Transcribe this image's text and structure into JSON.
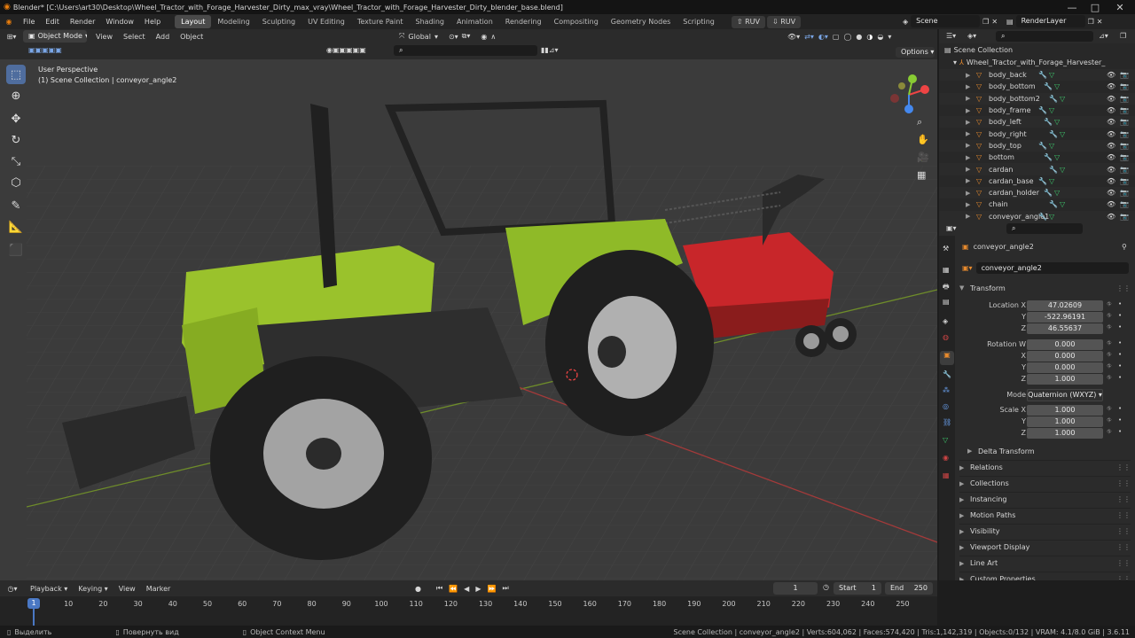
{
  "title_bar": {
    "text": "Blender* [C:\\Users\\art30\\Desktop\\Wheel_Tractor_with_Forage_Harvester_Dirty_max_vray\\Wheel_Tractor_with_Forage_Harvester_Dirty_blender_base.blend]"
  },
  "top_menu": {
    "items": [
      "File",
      "Edit",
      "Render",
      "Window",
      "Help"
    ]
  },
  "workspaces": {
    "items": [
      "Layout",
      "Modeling",
      "Sculpting",
      "UV Editing",
      "Texture Paint",
      "Shading",
      "Animation",
      "Rendering",
      "Compositing",
      "Geometry Nodes",
      "Scripting"
    ],
    "active": "Layout"
  },
  "ruv_buttons": [
    "RUV",
    "RUV"
  ],
  "scene": {
    "label": "Scene"
  },
  "render_layer": {
    "label": "RenderLayer"
  },
  "viewport_header": {
    "mode": "Object Mode",
    "menus": [
      "View",
      "Select",
      "Add",
      "Object"
    ],
    "orientation": "Global",
    "options_label": "Options"
  },
  "viewport": {
    "overlay_line1": "User Perspective",
    "overlay_line2": "(1) Scene Collection | conveyor_angle2"
  },
  "outliner": {
    "root": "Scene Collection",
    "collection": "Wheel_Tractor_with_Forage_Harvester_",
    "items": [
      "body_back",
      "body_bottom",
      "body_bottom2",
      "body_frame",
      "body_left",
      "body_right",
      "body_top",
      "bottom",
      "cardan",
      "cardan_base",
      "cardan_holder",
      "chain",
      "conveyor_angle1"
    ]
  },
  "properties": {
    "object_name": "conveyor_angle2",
    "data_name": "conveyor_angle2",
    "transform_label": "Transform",
    "location": {
      "label": "Location X",
      "x": "47.02609",
      "y": "-522.96191",
      "z": "46.55637"
    },
    "rotation": {
      "label": "Rotation W",
      "w": "0.000",
      "x": "0.000",
      "y": "0.000",
      "z": "1.000"
    },
    "mode": {
      "label": "Mode",
      "value": "Quaternion (WXYZ)"
    },
    "scale": {
      "label": "Scale X",
      "x": "1.000",
      "y": "1.000",
      "z": "1.000"
    },
    "axis_labels": {
      "y": "Y",
      "z": "Z",
      "x": "X"
    },
    "delta": "Delta Transform",
    "panels": [
      "Relations",
      "Collections",
      "Instancing",
      "Motion Paths",
      "Visibility",
      "Viewport Display",
      "Line Art",
      "Custom Properties"
    ]
  },
  "timeline": {
    "menus": [
      "Playback",
      "Keying",
      "View",
      "Marker"
    ],
    "current_frame": "1",
    "start_label": "Start",
    "start": "1",
    "end_label": "End",
    "end": "250",
    "ticks": [
      "1",
      "10",
      "20",
      "30",
      "40",
      "50",
      "60",
      "70",
      "80",
      "90",
      "100",
      "110",
      "120",
      "130",
      "140",
      "150",
      "160",
      "170",
      "180",
      "190",
      "200",
      "210",
      "220",
      "230",
      "240",
      "250"
    ]
  },
  "status_bar": {
    "select": "Выделить",
    "rotate": "Повернуть вид",
    "context": "Object Context Menu",
    "stats": "Scene Collection | conveyor_angle2 | Verts:604,062 | Faces:574,420 | Tris:1,142,319 | Objects:0/132 | VRAM: 4.1/8.0 GiB | 3.6.11"
  }
}
